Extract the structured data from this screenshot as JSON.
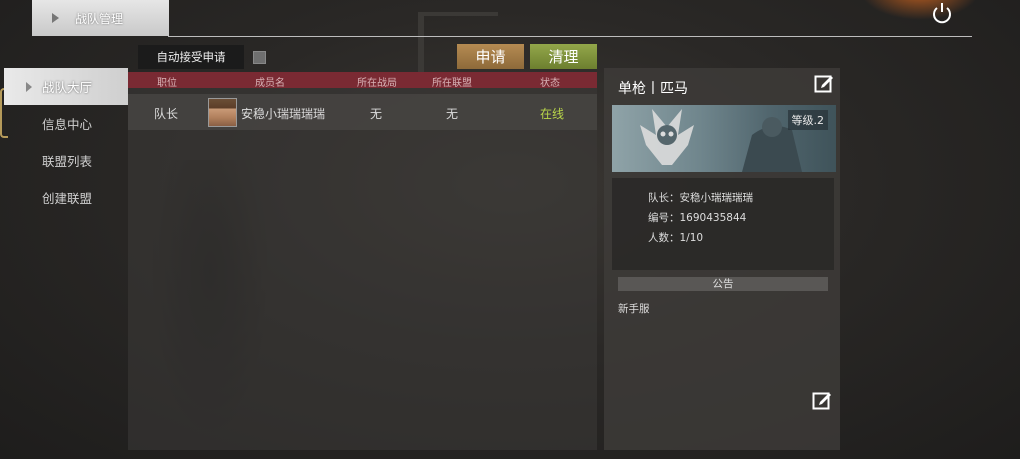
{
  "header": {
    "tab_label": "战队管理"
  },
  "menu": {
    "items": [
      {
        "label": "战队大厅"
      },
      {
        "label": "信息中心"
      },
      {
        "label": "联盟列表"
      },
      {
        "label": "创建联盟"
      }
    ]
  },
  "toolbar": {
    "auto_accept_label": "自动接受申请",
    "apply_label": "申请",
    "clear_label": "清理"
  },
  "members": {
    "columns": [
      "职位",
      "成员名",
      "所在战局",
      "所在联盟",
      "状态"
    ],
    "rows": [
      {
        "role": "队长",
        "name": "安稳小瑞瑞瑞瑞",
        "match": "无",
        "alliance": "无",
        "status": "在线"
      }
    ]
  },
  "team": {
    "title": "单枪丨匹马",
    "level": "等级.2",
    "captain": "队长：安稳小瑞瑞瑞瑞",
    "id": "编号：1690435844",
    "count": "人数：1/10",
    "notice_title": "公告",
    "notice_text": "新手服"
  },
  "colors": {
    "header_row": "#7a2a33",
    "apply_button": "#a07a46",
    "clear_button": "#7f9339",
    "online": "#b9d64a"
  }
}
